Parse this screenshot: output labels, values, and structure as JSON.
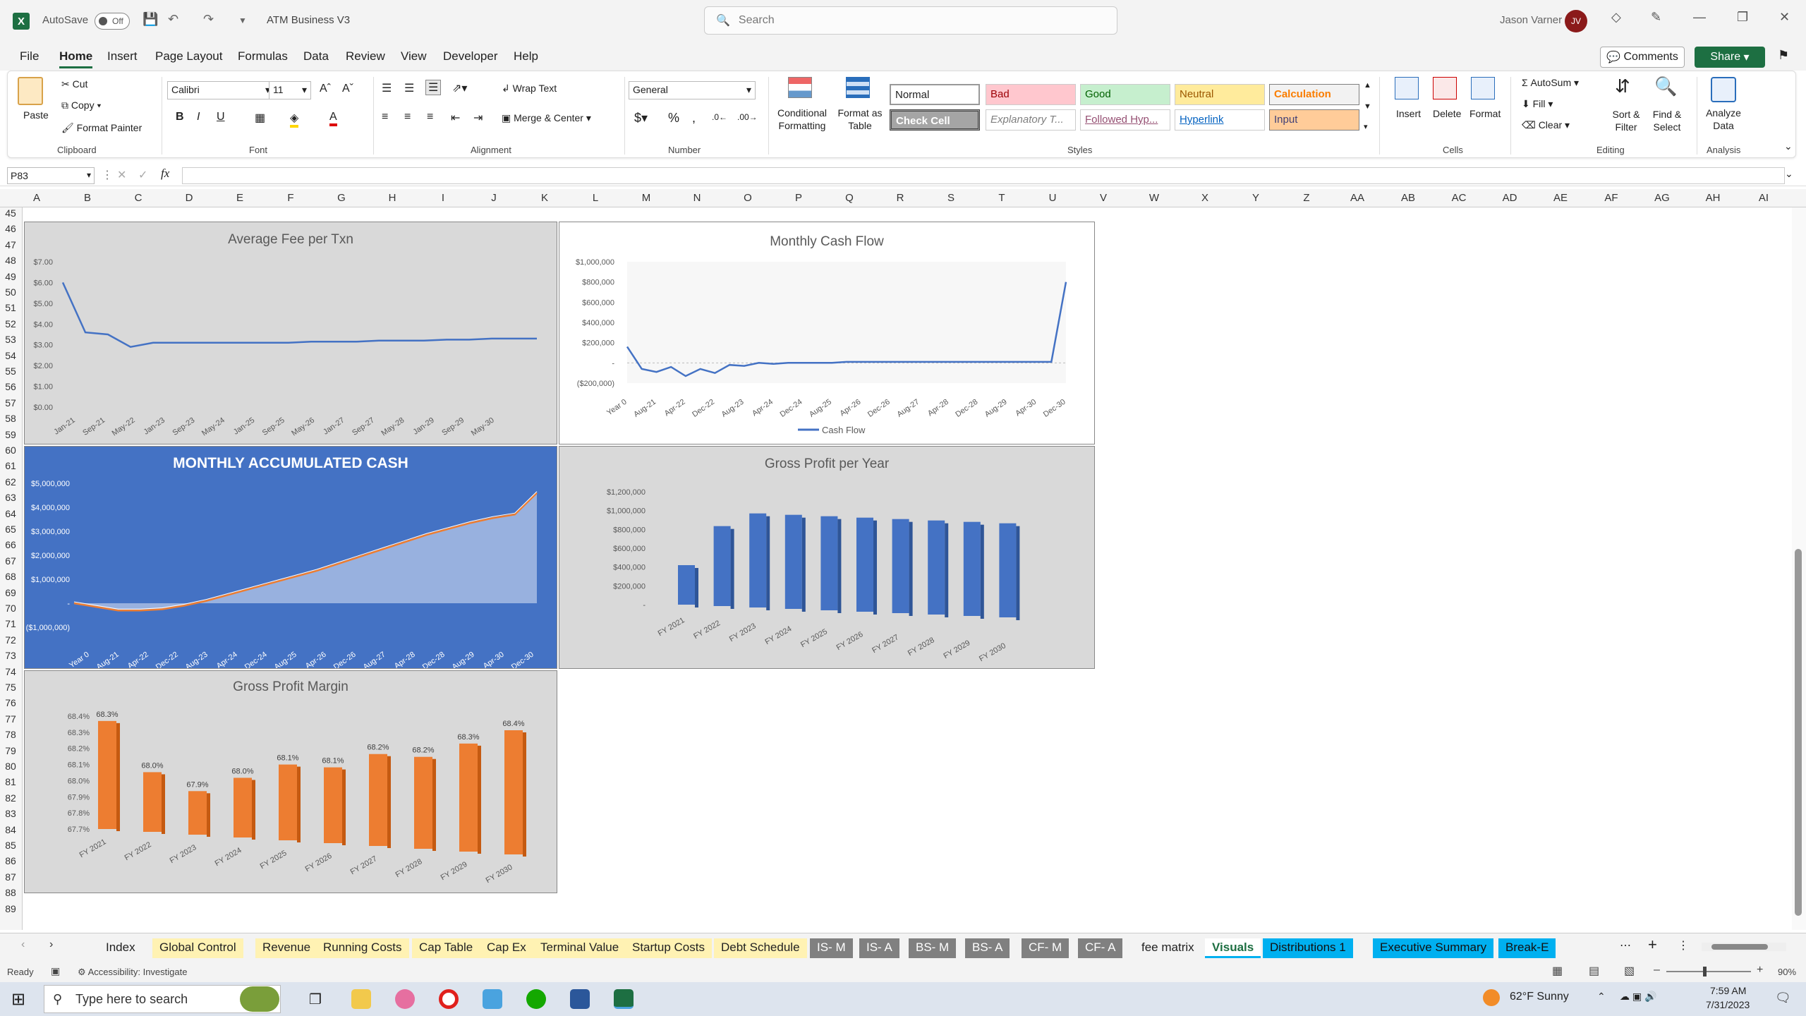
{
  "title_bar": {
    "autosave_label": "AutoSave",
    "autosave_state": "Off",
    "document_title": "ATM Business V3",
    "search_placeholder": "Search",
    "user_name": "Jason Varner",
    "user_initials": "JV"
  },
  "menu": {
    "items": [
      "File",
      "Home",
      "Insert",
      "Page Layout",
      "Formulas",
      "Data",
      "Review",
      "View",
      "Developer",
      "Help"
    ],
    "active": "Home",
    "comments_label": "Comments",
    "share_label": "Share"
  },
  "ribbon": {
    "clipboard": {
      "paste": "Paste",
      "cut": "Cut",
      "copy": "Copy",
      "format_painter": "Format Painter",
      "group": "Clipboard"
    },
    "font": {
      "name": "Calibri",
      "size": "11",
      "group": "Font"
    },
    "alignment": {
      "wrap_text": "Wrap Text",
      "merge_center": "Merge & Center",
      "group": "Alignment"
    },
    "number": {
      "format": "General",
      "group": "Number"
    },
    "styles": {
      "conditional": "Conditional Formatting",
      "format_table": "Format as Table",
      "cells": [
        "Normal",
        "Bad",
        "Good",
        "Neutral",
        "Calculation",
        "Check Cell",
        "Explanatory T...",
        "Followed Hyp...",
        "Hyperlink",
        "Input"
      ],
      "group": "Styles"
    },
    "cells": {
      "insert": "Insert",
      "delete": "Delete",
      "format": "Format",
      "group": "Cells"
    },
    "editing": {
      "autosum": "AutoSum",
      "fill": "Fill",
      "clear": "Clear",
      "sort_filter": "Sort & Filter",
      "find_select": "Find & Select",
      "group": "Editing"
    },
    "analysis": {
      "analyze": "Analyze Data",
      "group": "Analysis"
    }
  },
  "formula_bar": {
    "name_box": "P83",
    "fx": "fx",
    "formula": ""
  },
  "columns": [
    "A",
    "B",
    "C",
    "D",
    "E",
    "F",
    "G",
    "H",
    "I",
    "J",
    "K",
    "L",
    "M",
    "N",
    "O",
    "P",
    "Q",
    "R",
    "S",
    "T",
    "U",
    "V",
    "W",
    "X",
    "Y",
    "Z",
    "AA",
    "AB",
    "AC",
    "AD",
    "AE",
    "AF",
    "AG",
    "AH",
    "AI"
  ],
  "rows": [
    "45",
    "46",
    "47",
    "48",
    "49",
    "50",
    "51",
    "52",
    "53",
    "54",
    "55",
    "56",
    "57",
    "58",
    "59",
    "60",
    "61",
    "62",
    "63",
    "64",
    "65",
    "66",
    "67",
    "68",
    "69",
    "70",
    "71",
    "72",
    "73",
    "74",
    "75",
    "76",
    "77",
    "78",
    "79",
    "80",
    "81",
    "82",
    "83",
    "84",
    "85",
    "86",
    "87",
    "88",
    "89"
  ],
  "chart_data": [
    {
      "type": "line",
      "title": "Average Fee per Txn",
      "x_ticks": [
        "Jan-21",
        "Sep-21",
        "May-22",
        "Jan-23",
        "Sep-23",
        "May-24",
        "Jan-25",
        "Sep-25",
        "May-26",
        "Jan-27",
        "Sep-27",
        "May-28",
        "Jan-29",
        "Sep-29",
        "May-30"
      ],
      "y_ticks": [
        "$7.00",
        "$6.00",
        "$5.00",
        "$4.00",
        "$3.00",
        "$2.00",
        "$1.00",
        "$0.00"
      ],
      "ylim": [
        0,
        7
      ],
      "series": [
        {
          "values": [
            6.0,
            3.6,
            3.5,
            2.9,
            3.1,
            3.1,
            3.1,
            3.1,
            3.1,
            3.1,
            3.1,
            3.15,
            3.15,
            3.15,
            3.2,
            3.2,
            3.2,
            3.25,
            3.25,
            3.3,
            3.3,
            3.3
          ]
        }
      ]
    },
    {
      "type": "line",
      "title": "Monthly Cash Flow",
      "x_ticks": [
        "Year 0",
        "Aug-21",
        "Apr-22",
        "Dec-22",
        "Aug-23",
        "Apr-24",
        "Dec-24",
        "Aug-25",
        "Apr-26",
        "Dec-26",
        "Aug-27",
        "Apr-28",
        "Dec-28",
        "Aug-29",
        "Apr-30",
        "Dec-30"
      ],
      "y_ticks": [
        "$1,000,000",
        "$800,000",
        "$600,000",
        "$400,000",
        "$200,000",
        "-",
        "($200,000)"
      ],
      "ylim": [
        -200000,
        1000000
      ],
      "legend": "Cash Flow",
      "legend_position": "bottom",
      "series": [
        {
          "name": "Cash Flow",
          "values": [
            160000,
            -60000,
            -90000,
            -40000,
            -130000,
            -60000,
            -100000,
            -20000,
            -30000,
            0,
            -10000,
            0,
            0,
            0,
            0,
            10000,
            10000,
            10000,
            10000,
            10000,
            10000,
            10000,
            10000,
            10000,
            10000,
            10000,
            10000,
            10000,
            10000,
            10000,
            800000
          ]
        }
      ]
    },
    {
      "type": "area",
      "title": "MONTHLY ACCUMULATED CASH",
      "x_ticks": [
        "Year 0",
        "Aug-21",
        "Apr-22",
        "Dec-22",
        "Aug-23",
        "Apr-24",
        "Dec-24",
        "Aug-25",
        "Apr-26",
        "Dec-26",
        "Aug-27",
        "Apr-28",
        "Dec-28",
        "Aug-29",
        "Apr-30",
        "Dec-30"
      ],
      "y_ticks": [
        "$5,000,000",
        "$4,000,000",
        "$3,000,000",
        "$2,000,000",
        "$1,000,000",
        "-",
        "($1,000,000)"
      ],
      "ylim": [
        -1000000,
        5000000
      ],
      "series": [
        {
          "values": [
            0,
            -150000,
            -300000,
            -300000,
            -250000,
            -100000,
            100000,
            350000,
            600000,
            850000,
            1100000,
            1350000,
            1650000,
            1950000,
            2250000,
            2550000,
            2850000,
            3100000,
            3350000,
            3550000,
            3700000,
            4600000
          ]
        }
      ]
    },
    {
      "type": "bar",
      "title": "Gross Profit per Year",
      "categories": [
        "FY 2021",
        "FY 2022",
        "FY 2023",
        "FY 2024",
        "FY 2025",
        "FY 2026",
        "FY 2027",
        "FY 2028",
        "FY 2029",
        "FY 2030"
      ],
      "y_ticks": [
        "$1,200,000",
        "$1,000,000",
        "$800,000",
        "$600,000",
        "$400,000",
        "$200,000",
        "-"
      ],
      "ylim": [
        0,
        1200000
      ],
      "values": [
        420000,
        850000,
        1000000,
        1000000,
        1000000,
        1000000,
        1000000,
        1000000,
        1000000,
        1000000
      ]
    },
    {
      "type": "bar",
      "title": "Gross Profit Margin",
      "categories": [
        "FY 2021",
        "FY 2022",
        "FY 2023",
        "FY 2024",
        "FY 2025",
        "FY 2026",
        "FY 2027",
        "FY 2028",
        "FY 2029",
        "FY 2030"
      ],
      "y_ticks": [
        "68.4%",
        "68.3%",
        "68.2%",
        "68.1%",
        "68.0%",
        "67.9%",
        "67.8%",
        "67.7%"
      ],
      "ylim": [
        67.7,
        68.4
      ],
      "values": [
        68.3,
        68.0,
        67.9,
        68.0,
        68.1,
        68.1,
        68.2,
        68.2,
        68.3,
        68.4
      ],
      "data_labels": [
        "68.3%",
        "68.0%",
        "67.9%",
        "68.0%",
        "68.1%",
        "68.1%",
        "68.2%",
        "68.2%",
        "68.3%",
        "68.4%"
      ]
    }
  ],
  "sheet_tabs": [
    {
      "label": "Index",
      "color": ""
    },
    {
      "label": "Global Control",
      "color": "#fff2b3"
    },
    {
      "label": "Revenue",
      "color": "#fff2b3"
    },
    {
      "label": "Running Costs",
      "color": "#fff2b3"
    },
    {
      "label": "Cap Table",
      "color": "#fff2b3"
    },
    {
      "label": "Cap Ex",
      "color": "#fff2b3"
    },
    {
      "label": "Terminal Value",
      "color": "#fff2b3"
    },
    {
      "label": "Startup Costs",
      "color": "#fff2b3"
    },
    {
      "label": "Debt Schedule",
      "color": "#fff2b3"
    },
    {
      "label": "IS- M",
      "color": "#808080"
    },
    {
      "label": "IS- A",
      "color": "#808080"
    },
    {
      "label": "BS- M",
      "color": "#808080"
    },
    {
      "label": "BS- A",
      "color": "#808080"
    },
    {
      "label": "CF- M",
      "color": "#808080"
    },
    {
      "label": "CF- A",
      "color": "#808080"
    },
    {
      "label": "fee matrix",
      "color": ""
    },
    {
      "label": "Visuals",
      "color": "#00b0f0"
    },
    {
      "label": "Distributions 1",
      "color": "#00b0f0"
    },
    {
      "label": "Executive Summary",
      "color": "#00b0f0"
    },
    {
      "label": "Break-E",
      "color": "#00b0f0"
    }
  ],
  "active_tab": "Visuals",
  "status": {
    "ready": "Ready",
    "accessibility": "Accessibility: Investigate",
    "zoom": "90%"
  },
  "taskbar": {
    "search_placeholder": "Type here to search",
    "weather": "62°F  Sunny",
    "time": "7:59 AM",
    "date": "7/31/2023"
  }
}
